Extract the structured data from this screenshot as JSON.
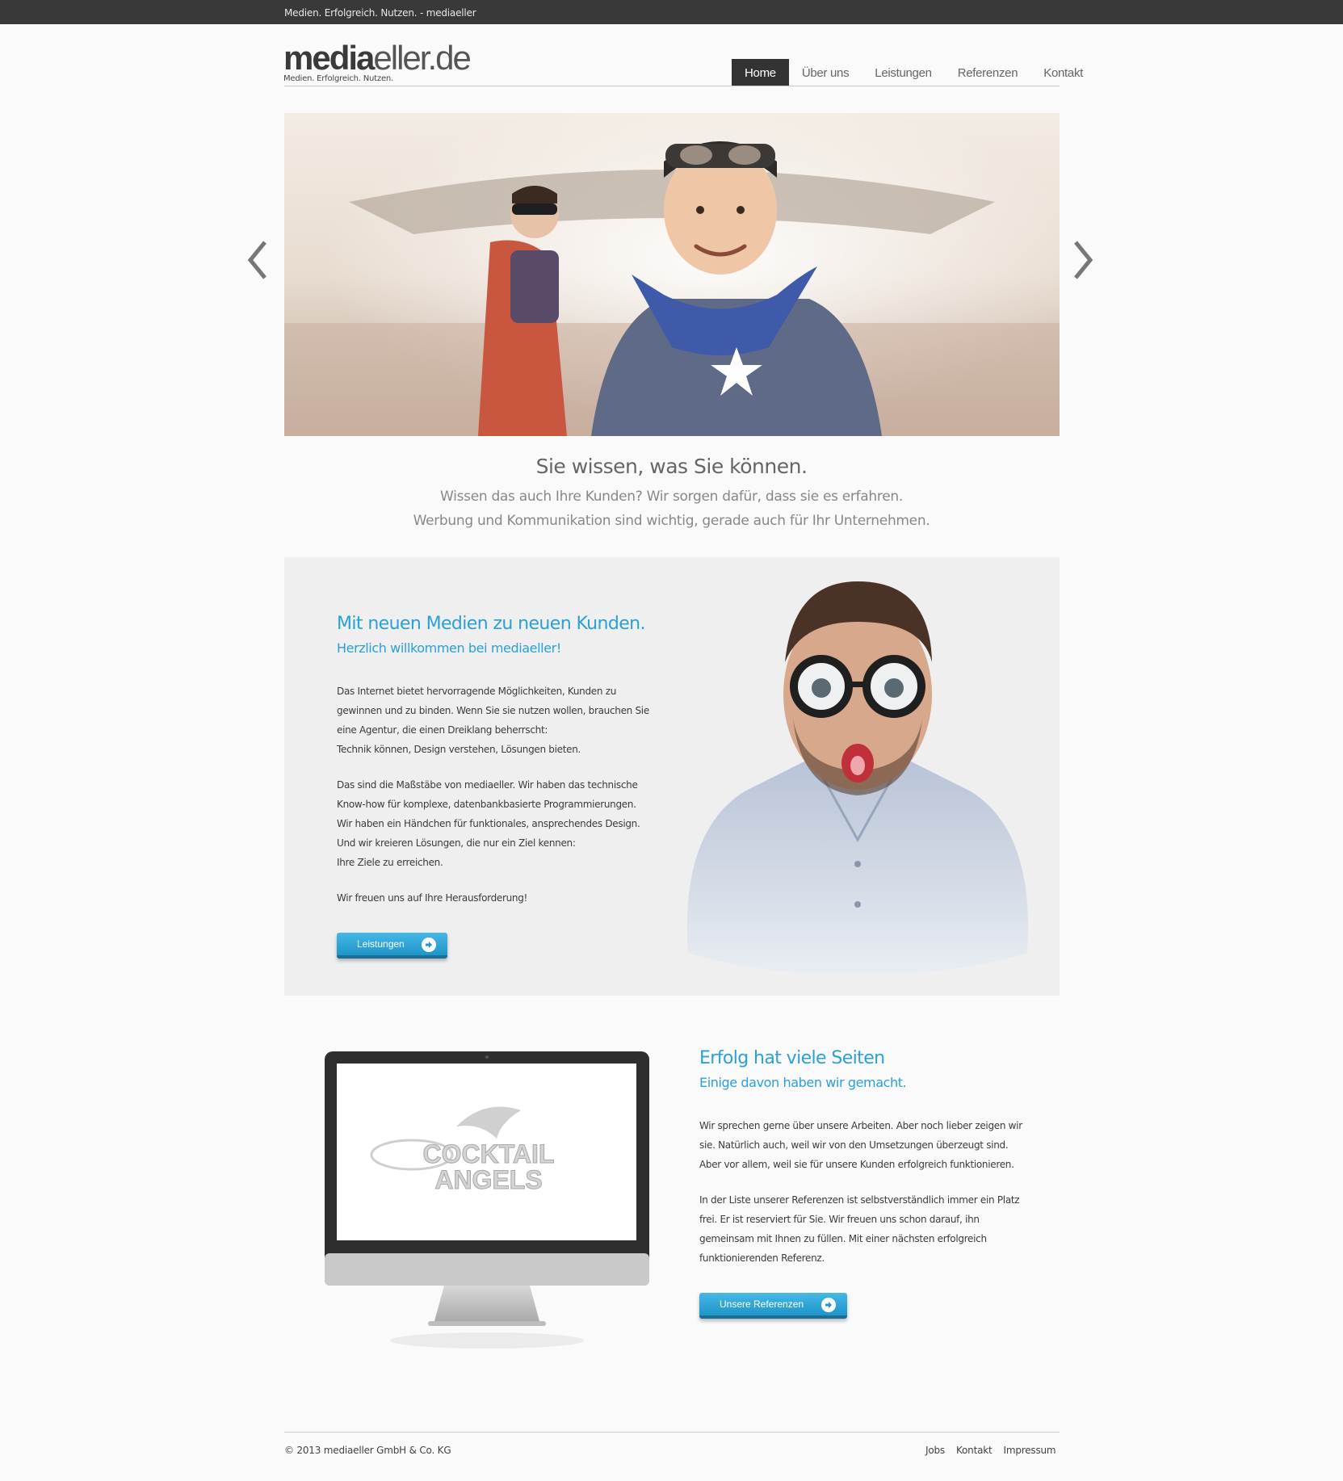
{
  "topbar": {
    "text": "Medien. Erfolgreich. Nutzen. - mediaeller"
  },
  "logo": {
    "strong": "media",
    "light": "eller.de",
    "tagline": "Medien. Erfolgreich. Nutzen."
  },
  "nav": {
    "items": [
      {
        "label": "Home",
        "active": true
      },
      {
        "label": "Über uns",
        "active": false
      },
      {
        "label": "Leistungen",
        "active": false
      },
      {
        "label": "Referenzen",
        "active": false
      },
      {
        "label": "Kontakt",
        "active": false
      }
    ]
  },
  "slider": {
    "prev_icon": "chevron-left-icon",
    "next_icon": "chevron-right-icon"
  },
  "intro": {
    "title": "Sie wissen, was Sie können.",
    "line1": "Wissen das auch Ihre Kunden? Wir sorgen dafür, dass sie es erfahren.",
    "line2": "Werbung und Kommunikation sind wichtig, gerade auch für Ihr Unternehmen."
  },
  "section1": {
    "title": "Mit neuen Medien zu neuen Kunden.",
    "subtitle": "Herzlich willkommen bei mediaeller!",
    "p1": [
      "Das Internet bietet hervorragende Möglichkeiten, Kunden zu",
      "gewinnen und zu binden. Wenn Sie sie nutzen wollen, brauchen Sie",
      "eine Agentur, die einen Dreiklang beherrscht:",
      "Technik können, Design verstehen, Lösungen bieten."
    ],
    "p2": [
      "Das sind die Maßstäbe von mediaeller. Wir haben das technische",
      "Know-how für komplexe, datenbankbasierte Programmierungen.",
      "Wir haben ein Händchen für funktionales, ansprechendes Design.",
      "Und wir kreieren Lösungen, die nur ein Ziel kennen:",
      "Ihre Ziele zu erreichen."
    ],
    "p3": [
      "Wir freuen uns auf Ihre Herausforderung!"
    ],
    "button": "Leistungen"
  },
  "section2": {
    "title": "Erfolg hat viele Seiten",
    "subtitle": "Einige davon haben wir gemacht.",
    "p1": [
      "Wir sprechen gerne über unsere Arbeiten. Aber noch lieber zeigen wir",
      "sie. Natürlich auch, weil wir von den Umsetzungen überzeugt sind.",
      "Aber vor allem, weil sie für unsere Kunden erfolgreich funktionieren."
    ],
    "p2": [
      "In der Liste unserer Referenzen ist selbstverständlich immer ein Platz",
      "frei. Er ist reserviert für Sie. Wir freuen uns schon darauf, ihn",
      "gemeinsam mit Ihnen zu füllen. Mit einer nächsten erfolgreich",
      "funktionierenden Referenz."
    ],
    "button": "Unsere Referenzen",
    "screen_logo": {
      "line1": "COCKTAIL",
      "line2": "ANGELS"
    }
  },
  "footer": {
    "copyright": "© 2013 mediaeller GmbH & Co. KG",
    "links": [
      "Jobs",
      "Kontakt",
      "Impressum"
    ]
  },
  "colors": {
    "accent": "#2aa0d8",
    "topbar": "#393939",
    "nav_active": "#333333"
  }
}
